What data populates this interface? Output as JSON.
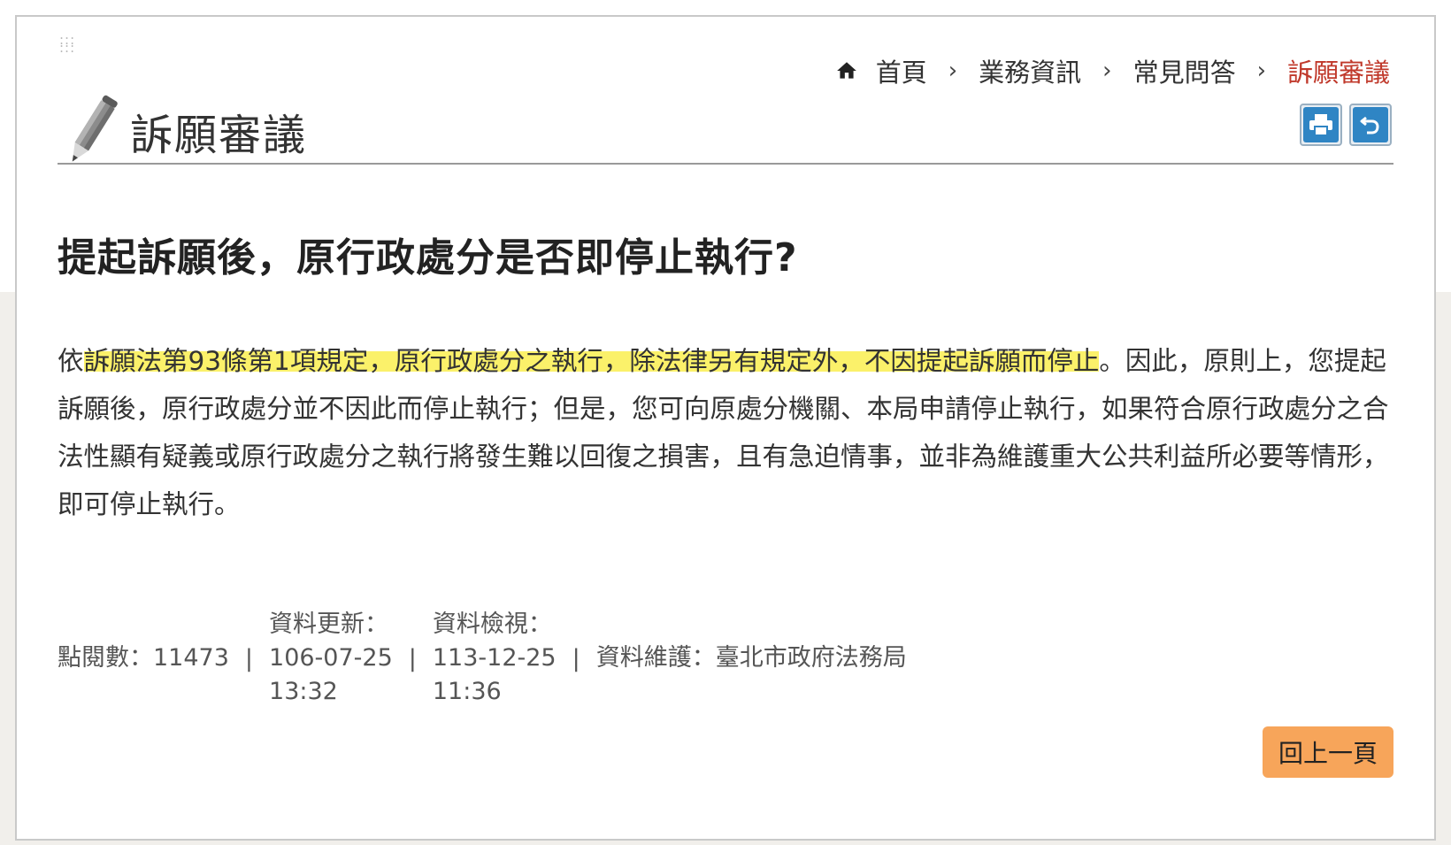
{
  "breadcrumb": {
    "home": "首頁",
    "items": [
      "業務資訊",
      "常見問答"
    ],
    "current": "訴願審議",
    "separator": "›"
  },
  "page": {
    "title": "訴願審議"
  },
  "tools": {
    "print_icon": "print-icon",
    "back_icon": "return-icon"
  },
  "article": {
    "question": "提起訴願後，原行政處分是否即停止執行?",
    "answer_prefix": "依",
    "answer_highlight": "訴願法第93條第1項規定，原行政處分之執行，除法律另有規定外，不因提起訴願而停止",
    "answer_rest": "。因此，原則上，您提起訴願後，原行政處分並不因此而停止執行；但是，您可向原處分機關、本局申請停止執行，如果符合原行政處分之合法性顯有疑義或原行政處分之執行將發生難以回復之損害，且有急迫情事，並非為維護重大公共利益所必要等情形，即可停止執行。"
  },
  "meta": {
    "views": "點閱數：11473",
    "updated_label": "資料更新：",
    "updated_date": "106-07-25",
    "updated_time": "13:32",
    "reviewed_label": "資料檢視：",
    "reviewed_date": "113-12-25",
    "reviewed_time": "11:36",
    "maintainer": "資料維護：臺北市政府法務局",
    "pipe": "|"
  },
  "back_button": "回上一頁",
  "colors": {
    "accent": "#c0392b",
    "tool_blue": "#2f85c4",
    "highlight": "#fbf16a",
    "back_button_bg": "#f7a55a"
  }
}
